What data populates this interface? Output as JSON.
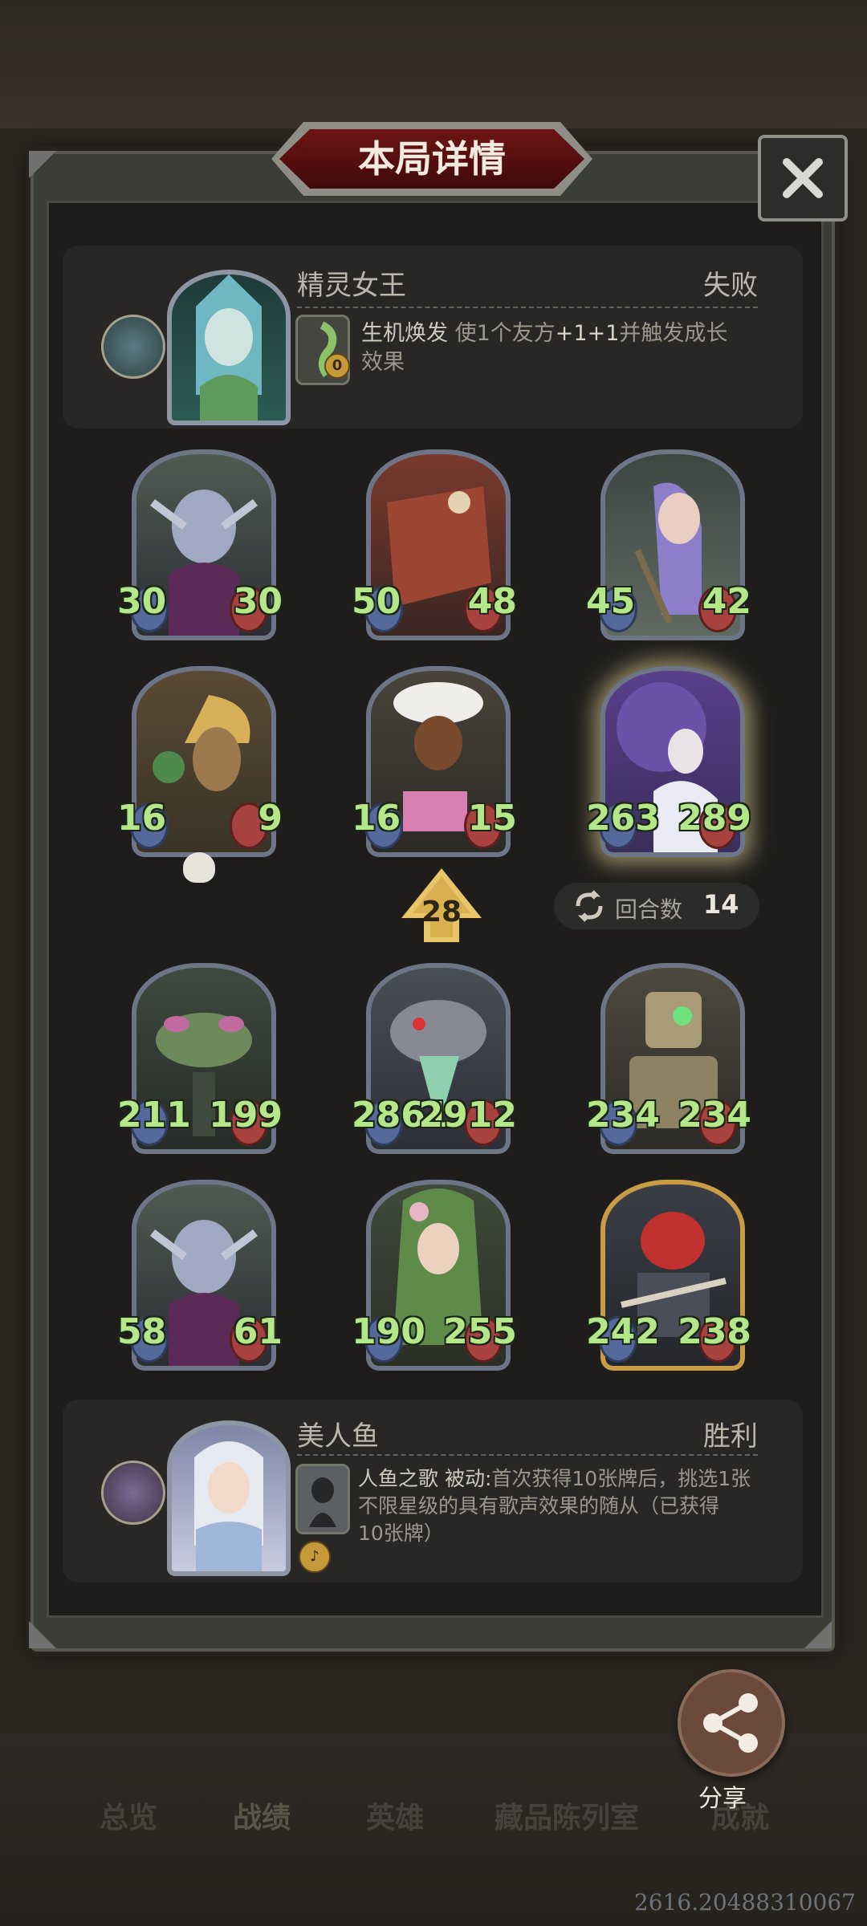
{
  "title": "本局详情",
  "opponent": {
    "name": "精灵女王",
    "result": "失败",
    "power_name": "生机焕发",
    "power_desc_prefix": "使1个友方",
    "power_desc_stat": "+1+1",
    "power_desc_suffix": "并触发成长",
    "power_desc_line2": "效果",
    "power_cost": "0"
  },
  "minions_top": [
    {
      "atk": "30",
      "hp": "30"
    },
    {
      "atk": "50",
      "hp": "48"
    },
    {
      "atk": "45",
      "hp": "42"
    },
    {
      "atk": "16",
      "hp": "9"
    },
    {
      "atk": "16",
      "hp": "15"
    },
    {
      "atk": "263",
      "hp": "289"
    }
  ],
  "tier": "28",
  "turns": {
    "label": "回合数",
    "value": "14"
  },
  "minions_bottom": [
    {
      "atk": "211",
      "hp": "199"
    },
    {
      "atk": "2861",
      "hp": "2912"
    },
    {
      "atk": "234",
      "hp": "234"
    },
    {
      "atk": "58",
      "hp": "61"
    },
    {
      "atk": "190",
      "hp": "255"
    },
    {
      "atk": "242",
      "hp": "238"
    }
  ],
  "player": {
    "name": "美人鱼",
    "result": "胜利",
    "power_name": "人鱼之歌",
    "power_type": "被动:",
    "power_desc_line1": "首次获得10张牌后，挑选1张",
    "power_desc_line2": "不限星级的具有歌声效果的随从（已获得",
    "power_desc_line3": "10张牌）"
  },
  "share_label": "分享",
  "nav": {
    "overview": "总览",
    "record": "战绩",
    "heroes": "英雄",
    "collection": "藏品陈列室",
    "achievements": "成就"
  },
  "watermark": "2616.20488310067",
  "colors": {
    "attack": "#b5e68a",
    "frame": "#3b3e36",
    "banner": "#6e1414",
    "gold": "#c79c44"
  }
}
